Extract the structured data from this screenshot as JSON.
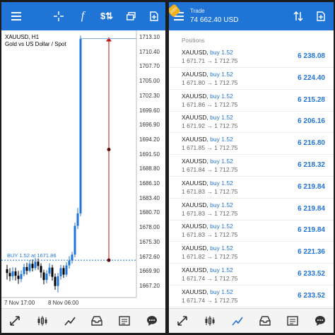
{
  "chart": {
    "symbol": "XAUUSD, H1",
    "description": "Gold vs US Dollar / Spot",
    "price_labels": [
      "1713.10",
      "1710.40",
      "1707.70",
      "1705.00",
      "1702.30",
      "1699.60",
      "1696.90",
      "1694.20",
      "1691.50",
      "1688.80",
      "1686.10",
      "1683.40",
      "1680.70",
      "1678.00",
      "1675.30",
      "1672.60",
      "1669.90",
      "1667.20"
    ],
    "time_labels": [
      "7 Nov 17:00",
      "8 Nov 06:00"
    ],
    "order_line_label": "BUY 1.52 at 1671.86",
    "top_icons": [
      "menu-icon",
      "crosshair-icon",
      "function-icon",
      "objects-icon",
      "window-icon",
      "new-order-icon"
    ],
    "bottom_icons": [
      "quotes-icon",
      "chart-icon",
      "trend-icon",
      "trade-icon",
      "history-icon",
      "chat-icon"
    ]
  },
  "trade": {
    "title": "Trade",
    "balance": "74 662.40 USD",
    "section": "Positions",
    "badge": "2020",
    "top_icons": [
      "menu-icon",
      "sort-icon",
      "new-order-icon"
    ],
    "bottom_icons": [
      "quotes-icon",
      "chart-icon",
      "trend-icon",
      "trade-icon",
      "history-icon",
      "chat-icon"
    ],
    "positions": [
      {
        "symbol": "XAUUSD,",
        "side": "buy 1.52",
        "prices": "1 671.71 → 1 712.75",
        "profit": "6 238.08"
      },
      {
        "symbol": "XAUUSD,",
        "side": "buy 1.52",
        "prices": "1 671.80 → 1 712.75",
        "profit": "6 224.40"
      },
      {
        "symbol": "XAUUSD,",
        "side": "buy 1.52",
        "prices": "1 671.86 → 1 712.75",
        "profit": "6 215.28"
      },
      {
        "symbol": "XAUUSD,",
        "side": "buy 1.52",
        "prices": "1 671.92 → 1 712.75",
        "profit": "6 206.16"
      },
      {
        "symbol": "XAUUSD,",
        "side": "buy 1.52",
        "prices": "1 671.85 → 1 712.75",
        "profit": "6 216.80"
      },
      {
        "symbol": "XAUUSD,",
        "side": "buy 1.52",
        "prices": "1 671.84 → 1 712.75",
        "profit": "6 218.32"
      },
      {
        "symbol": "XAUUSD,",
        "side": "buy 1.52",
        "prices": "1 671.83 → 1 712.75",
        "profit": "6 219.84"
      },
      {
        "symbol": "XAUUSD,",
        "side": "buy 1.52",
        "prices": "1 671.83 → 1 712.75",
        "profit": "6 219.84"
      },
      {
        "symbol": "XAUUSD,",
        "side": "buy 1.52",
        "prices": "1 671.83 → 1 712.75",
        "profit": "6 219.84"
      },
      {
        "symbol": "XAUUSD,",
        "side": "buy 1.52",
        "prices": "1 671.82 → 1 712.75",
        "profit": "6 221.36"
      },
      {
        "symbol": "XAUUSD,",
        "side": "buy 1.52",
        "prices": "1 671.74 → 1 712.75",
        "profit": "6 233.52"
      },
      {
        "symbol": "XAUUSD,",
        "side": "buy 1.52",
        "prices": "1 671.74 → 1 712.75",
        "profit": "6 233.52"
      }
    ]
  },
  "colors": {
    "accent": "#1f74d6",
    "bull": "#1f74d6",
    "bear": "#000000",
    "line": "#cc1111"
  }
}
